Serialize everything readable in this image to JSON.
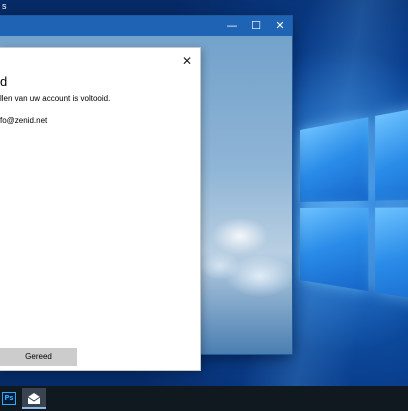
{
  "desktop": {
    "top_label": "s"
  },
  "app_window": {
    "title_buttons": {
      "minimize": "—",
      "maximize": "☐",
      "close": "✕"
    }
  },
  "dialog": {
    "close_glyph": "✕",
    "title": "d",
    "message": "llen van uw account is voltooid.",
    "email": "fo@zenid.net",
    "done_label": "Gereed"
  },
  "taskbar": {
    "items": [
      {
        "name": "photoshop",
        "label": "Ps",
        "accent": "#31a8ff"
      },
      {
        "name": "mail",
        "icon": "mail-icon",
        "active": true
      }
    ]
  },
  "colors": {
    "titlebar": "#1f63b5",
    "taskbar": "#101820",
    "button_bg": "#cccccc"
  }
}
